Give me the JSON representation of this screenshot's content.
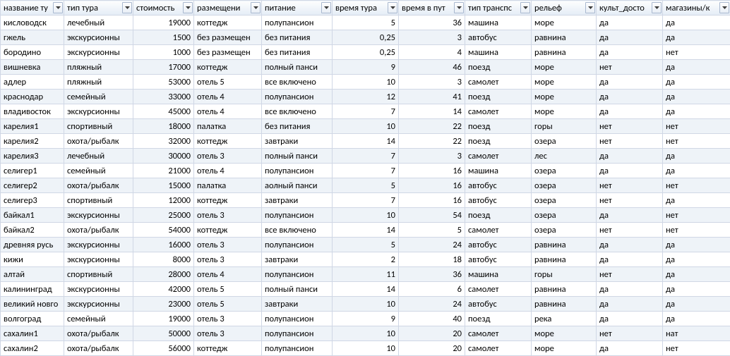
{
  "table": {
    "headers": [
      "название ту",
      "тип тура",
      "стоимость",
      "размещени",
      "питание",
      "время тура",
      "время в пут",
      "тип транспс",
      "рельеф",
      "культ_досто",
      "магазины/к"
    ],
    "numeric_cols": [
      2,
      5,
      6
    ],
    "rows": [
      [
        "кисловодск",
        "лечебный",
        "19000",
        "коттедж",
        "полупансион",
        "5",
        "36",
        "машина",
        "море",
        "да",
        "да"
      ],
      [
        "гжель",
        "экскурсионны",
        "1500",
        "без размещен",
        "без питания",
        "0,25",
        "3",
        "автобус",
        "равнина",
        "да",
        "да"
      ],
      [
        "бородино",
        "экскурсионны",
        "1000",
        "без размещен",
        "без питания",
        "0,25",
        "4",
        "машина",
        "равнина",
        "да",
        "нет"
      ],
      [
        "вишневка",
        "пляжный",
        "17000",
        "коттедж",
        "полный панси",
        "9",
        "46",
        "поезд",
        "море",
        "нет",
        "да"
      ],
      [
        "адлер",
        "пляжный",
        "53000",
        "отель 5",
        "все включено",
        "10",
        "3",
        "самолет",
        "море",
        "да",
        "да"
      ],
      [
        "краснодар",
        "семейный",
        "33000",
        "отель 4",
        "полупансион",
        "12",
        "41",
        "поезд",
        "море",
        "да",
        "да"
      ],
      [
        "владивосток",
        "экскурсионны",
        "45000",
        "отель 4",
        "все включено",
        "7",
        "14",
        "самолет",
        "море",
        "да",
        "да"
      ],
      [
        "карелия1",
        "спортивный",
        "18000",
        "палатка",
        "без питания",
        "10",
        "22",
        "поезд",
        "горы",
        "нет",
        "нет"
      ],
      [
        "карелия2",
        "охота/рыбалк",
        "32000",
        "коттедж",
        "завтраки",
        "14",
        "22",
        "поезд",
        "озера",
        "нет",
        "нет"
      ],
      [
        "карелия3",
        "лечебный",
        "30000",
        "отель 3",
        "полный панси",
        "7",
        "3",
        "самолет",
        "лес",
        "да",
        "да"
      ],
      [
        "селигер1",
        "семейный",
        "21000",
        "отель 4",
        "полупансион",
        "7",
        "16",
        "машина",
        "озера",
        "да",
        "да"
      ],
      [
        "селигер2",
        "охота/рыбалк",
        "15000",
        "палатка",
        "аолный панси",
        "5",
        "16",
        "автобус",
        "озера",
        "нет",
        "нет"
      ],
      [
        "селигер3",
        "спортивный",
        "12000",
        "коттедж",
        "завтраки",
        "7",
        "16",
        "автобус",
        "озера",
        "нет",
        "да"
      ],
      [
        "байкал1",
        "экскурсионны",
        "25000",
        "отель 3",
        "полупансион",
        "10",
        "54",
        "поезд",
        "озера",
        "да",
        "нет"
      ],
      [
        "байкал2",
        "охота/рыбалк",
        "54000",
        "коттедж",
        "все включено",
        "14",
        "5",
        "самолет",
        "озера",
        "нет",
        "нет"
      ],
      [
        "древняя русь",
        "экскурсионны",
        "16000",
        "отель 3",
        "полупансион",
        "5",
        "24",
        "автобус",
        "равнина",
        "да",
        "да"
      ],
      [
        "кижи",
        "экскурсионны",
        "8000",
        "отель 3",
        "завтраки",
        "2",
        "18",
        "автобус",
        "равнина",
        "да",
        "да"
      ],
      [
        "алтай",
        "спортивный",
        "28000",
        "отель 4",
        "полупансион",
        "11",
        "36",
        "машина",
        "горы",
        "нет",
        "да"
      ],
      [
        "калининград",
        "экскурсионны",
        "42000",
        "отель 5",
        "полный панси",
        "14",
        "6",
        "самолет",
        "равнина",
        "да",
        "да"
      ],
      [
        "великий новго",
        "экскурсионны",
        "23000",
        "отель 5",
        "завтраки",
        "10",
        "24",
        "автобус",
        "равнина",
        "да",
        "да"
      ],
      [
        "волгоград",
        "семейный",
        "19000",
        "отель 3",
        "полупансион",
        "9",
        "40",
        "поезд",
        "река",
        "да",
        "да"
      ],
      [
        "сахалин1",
        "охота/рыбалк",
        "50000",
        "отель 3",
        "полупансион",
        "10",
        "20",
        "самолет",
        "море",
        "нет",
        "нат"
      ],
      [
        "сахалин2",
        "охота/рыбалк",
        "56000",
        "коттедж",
        "полупансион",
        "10",
        "20",
        "самолет",
        "море",
        "да",
        "нет"
      ]
    ]
  }
}
